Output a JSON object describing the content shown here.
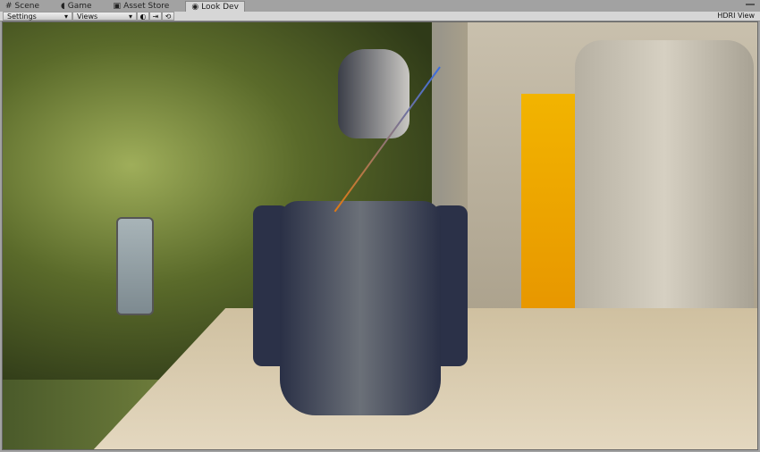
{
  "tabs": [
    {
      "label": "Scene",
      "icon": "grid-icon"
    },
    {
      "label": "Game",
      "icon": "pacman-icon"
    },
    {
      "label": "Asset Store",
      "icon": "store-icon"
    },
    {
      "label": "Look Dev",
      "icon": "eye-icon",
      "active": true
    }
  ],
  "toolbar": {
    "settings": "Settings",
    "views": "Views",
    "view_mode": "HDRI View"
  }
}
